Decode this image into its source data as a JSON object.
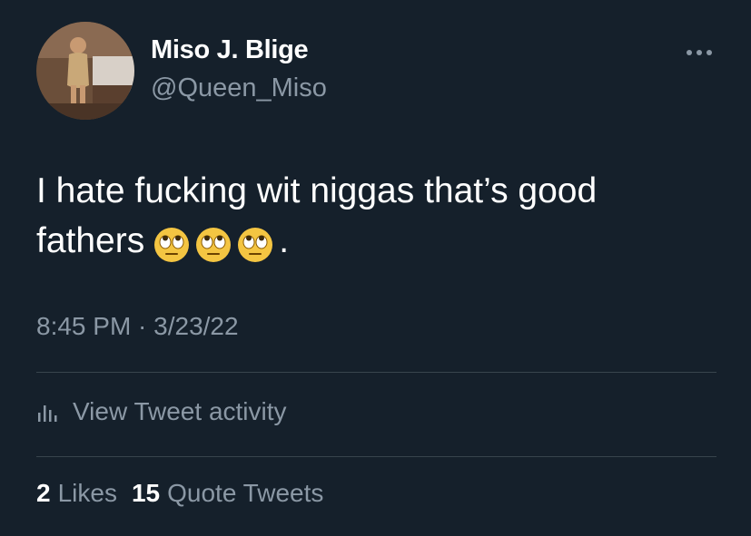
{
  "tweet": {
    "author": {
      "display_name": "Miso J. Blige",
      "handle": "@Queen_Miso",
      "avatar_icon": "profile-photo"
    },
    "more_icon": "ellipsis-icon",
    "text_line_1": "I hate fucking wit niggas that’s good",
    "text_line_2": "fathers",
    "emojis": [
      "face-with-rolling-eyes",
      "face-with-rolling-eyes",
      "face-with-rolling-eyes"
    ],
    "text_end": ".",
    "timestamp": "8:45 PM · 3/23/22",
    "activity": {
      "icon": "bar-chart-icon",
      "label": "View Tweet activity"
    },
    "stats": {
      "likes_count": "2",
      "likes_label": "Likes",
      "quotes_count": "15",
      "quotes_label": "Quote Tweets"
    }
  },
  "colors": {
    "background": "#15202b",
    "primary_text": "#ffffff",
    "secondary_text": "#8b98a5",
    "divider": "#38444d"
  }
}
